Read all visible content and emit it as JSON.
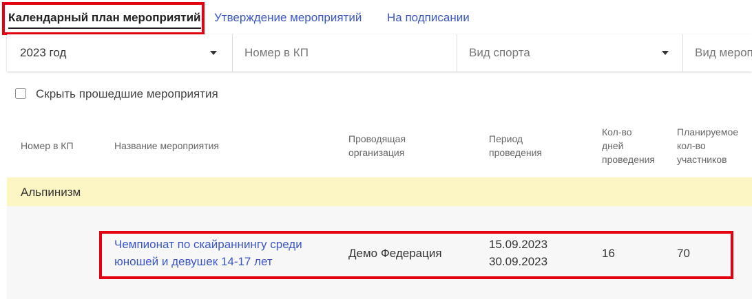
{
  "tabs": [
    {
      "label": "Календарный план мероприятий",
      "active": true
    },
    {
      "label": "Утверждение мероприятий",
      "active": false
    },
    {
      "label": "На подписании",
      "active": false
    }
  ],
  "filters": {
    "year": {
      "value": "2023 год"
    },
    "plan_number": {
      "placeholder": "Номер в КП"
    },
    "sport_type": {
      "placeholder": "Вид спорта"
    },
    "event_type": {
      "placeholder": "Вид мероп"
    }
  },
  "hide_past": {
    "label": "Скрыть прошедшие мероприятия",
    "checked": false
  },
  "table": {
    "headers": {
      "number": "Номер в КП",
      "name": "Название мероприятия",
      "org_1": "Проводящая",
      "org_2": "организация",
      "period_1": "Период",
      "period_2": "проведения",
      "days_1": "Кол-во",
      "days_2": "дней",
      "days_3": "проведения",
      "participants_1": "Планируемое",
      "participants_2": "кол-во",
      "participants_3": "участников"
    },
    "groups": [
      {
        "name": "Альпинизм",
        "rows": [
          {
            "number": "",
            "name_1": "Чемпионат по скайраннингу среди",
            "name_2": "юношей и девушек 14-17 лет",
            "organization": "Демо Федерация",
            "date_start": "15.09.2023",
            "date_end": "30.09.2023",
            "days": "16",
            "participants": "70"
          }
        ]
      }
    ]
  },
  "colors": {
    "accent_link": "#3b57c4",
    "highlight": "#e3000f",
    "group_background": "#fcf5c4"
  },
  "icons": {
    "dropdown": "caret-down-icon",
    "checkbox": "checkbox-icon"
  }
}
